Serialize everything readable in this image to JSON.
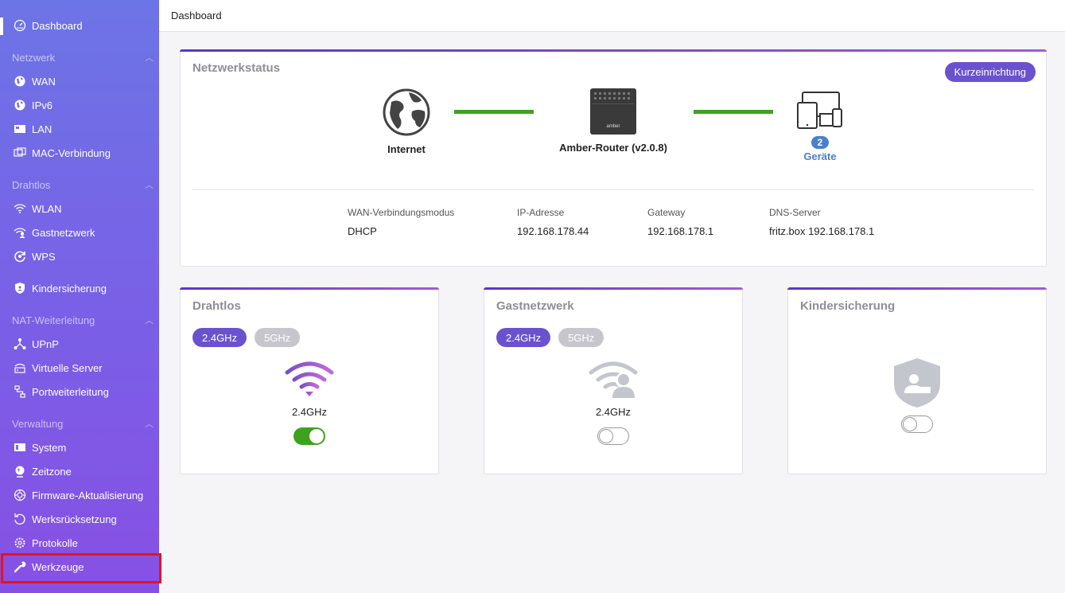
{
  "sidebar": {
    "dashboard": "Dashboard",
    "sections": {
      "netzwerk": "Netzwerk",
      "drahtlos": "Drahtlos",
      "nat": "NAT-Weiterleitung",
      "verwaltung": "Verwaltung"
    },
    "items": {
      "wan": "WAN",
      "ipv6": "IPv6",
      "lan": "LAN",
      "mac": "MAC-Verbindung",
      "wlan": "WLAN",
      "gast": "Gastnetzwerk",
      "wps": "WPS",
      "kinder": "Kindersicherung",
      "upnp": "UPnP",
      "virtuelle": "Virtuelle Server",
      "portweiter": "Portweiterleitung",
      "system": "System",
      "zeitzone": "Zeitzone",
      "firmware": "Firmware-Aktualisierung",
      "werksruck": "Werksrücksetzung",
      "protokolle": "Protokolle",
      "werkzeuge": "Werkzeuge"
    }
  },
  "topbar": {
    "title": "Dashboard"
  },
  "netzwerkstatus": {
    "title": "Netzwerkstatus",
    "quick_setup": "Kurzeinrichtung",
    "internet": "Internet",
    "router": "Amber-Router (v2.0.8)",
    "router_brand": "amber",
    "devices_count": "2",
    "devices_label": "Geräte",
    "info": [
      {
        "label": "WAN-Verbindungsmodus",
        "value": "DHCP"
      },
      {
        "label": "IP-Adresse",
        "value": "192.168.178.44"
      },
      {
        "label": "Gateway",
        "value": "192.168.178.1"
      },
      {
        "label": "DNS-Server",
        "value": "fritz.box 192.168.178.1"
      }
    ],
    "link_color": "#3fa21f"
  },
  "drahtlos": {
    "title": "Drahtlos",
    "band_24": "2.4GHz",
    "band_5": "5GHz",
    "current": "2.4GHz",
    "enabled": true
  },
  "gastnetzwerk": {
    "title": "Gastnetzwerk",
    "band_24": "2.4GHz",
    "band_5": "5GHz",
    "current": "2.4GHz",
    "enabled": false
  },
  "kindersicherung": {
    "title": "Kindersicherung",
    "enabled": false
  },
  "colors": {
    "accent": "#6a52cf",
    "toggle_on": "#3fa21f",
    "highlight": "#e8121c"
  }
}
